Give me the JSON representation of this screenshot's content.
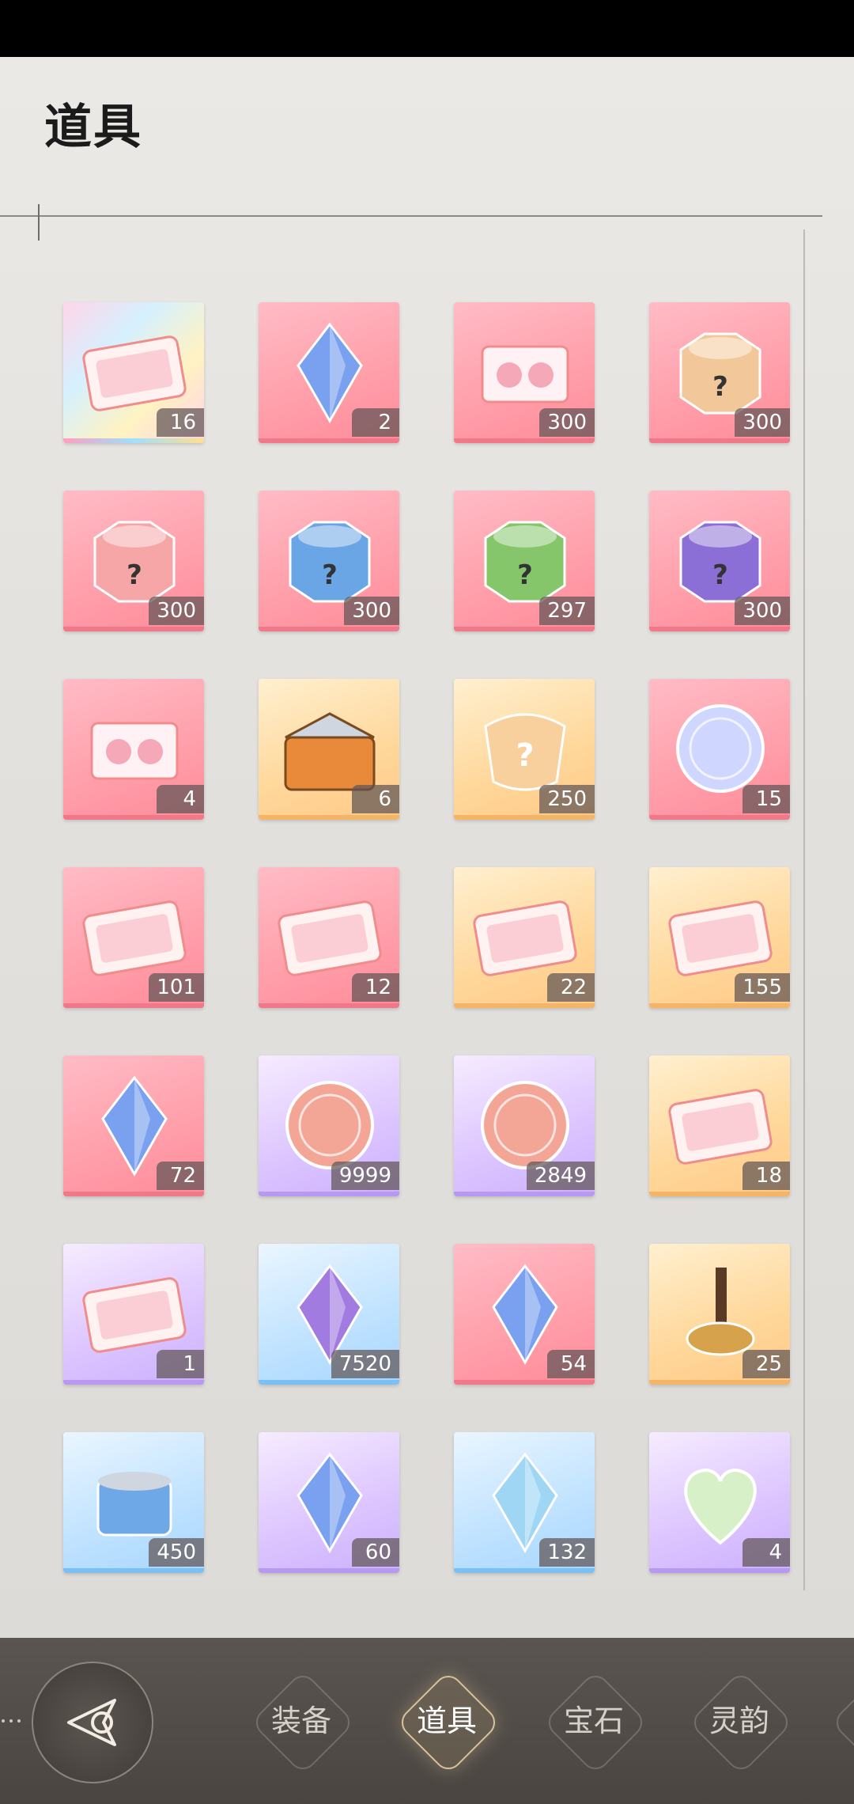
{
  "page": {
    "title": "道具"
  },
  "items": [
    {
      "count": "16",
      "icon": "rainbow-mystery-card-pack-icon",
      "rarity": "rainbow"
    },
    {
      "count": "2",
      "icon": "green-gem-gift-box-icon",
      "rarity": "pink"
    },
    {
      "count": "300",
      "icon": "pink-rose-gift-box-icon",
      "rarity": "pink"
    },
    {
      "count": "300",
      "icon": "orange-mystery-box-icon",
      "rarity": "pink"
    },
    {
      "count": "300",
      "icon": "pink-mystery-box-icon",
      "rarity": "pink"
    },
    {
      "count": "300",
      "icon": "blue-mystery-box-icon",
      "rarity": "pink"
    },
    {
      "count": "297",
      "icon": "green-mystery-box-icon",
      "rarity": "pink"
    },
    {
      "count": "300",
      "icon": "purple-mystery-box-icon",
      "rarity": "pink"
    },
    {
      "count": "4",
      "icon": "pink-gift-tray-icon",
      "rarity": "pink"
    },
    {
      "count": "6",
      "icon": "treasure-chest-icon",
      "rarity": "orange"
    },
    {
      "count": "250",
      "icon": "mystery-fragment-icon",
      "rarity": "orange"
    },
    {
      "count": "15",
      "icon": "dress-coin-icon",
      "rarity": "pink"
    },
    {
      "count": "101",
      "icon": "fashion-ticket-icon",
      "rarity": "pink"
    },
    {
      "count": "12",
      "icon": "portrait-card-icon",
      "rarity": "pink"
    },
    {
      "count": "22",
      "icon": "cat-ticket-icon",
      "rarity": "orange"
    },
    {
      "count": "155",
      "icon": "star-portrait-card-icon",
      "rarity": "orange"
    },
    {
      "count": "72",
      "icon": "blue-crystal-icon",
      "rarity": "pink"
    },
    {
      "count": "9999",
      "icon": "bronze-flower-coin-icon",
      "rarity": "purple"
    },
    {
      "count": "2849",
      "icon": "bronze-flower-coin-icon",
      "rarity": "purple"
    },
    {
      "count": "18",
      "icon": "letter-cards-icon",
      "rarity": "orange"
    },
    {
      "count": "1",
      "icon": "purple-card-icon",
      "rarity": "purple"
    },
    {
      "count": "7520",
      "icon": "purple-teardrop-gem-icon",
      "rarity": "blue"
    },
    {
      "count": "54",
      "icon": "crystal-butterfly-icon",
      "rarity": "pink"
    },
    {
      "count": "25",
      "icon": "wax-seal-stamp-icon",
      "rarity": "orange"
    },
    {
      "count": "450",
      "icon": "cat-food-can-icon",
      "rarity": "blue"
    },
    {
      "count": "60",
      "icon": "crystal-shard-box-icon",
      "rarity": "purple"
    },
    {
      "count": "132",
      "icon": "ice-crystal-cluster-icon",
      "rarity": "blue"
    },
    {
      "count": "4",
      "icon": "heart-portrait-badge-icon",
      "rarity": "purple"
    }
  ],
  "tabs": [
    {
      "label": "装备",
      "active": false
    },
    {
      "label": "道具",
      "active": true
    },
    {
      "label": "宝石",
      "active": false
    },
    {
      "label": "灵韵",
      "active": false
    }
  ],
  "nav": {
    "back_icon": "back-arrow-icon"
  }
}
